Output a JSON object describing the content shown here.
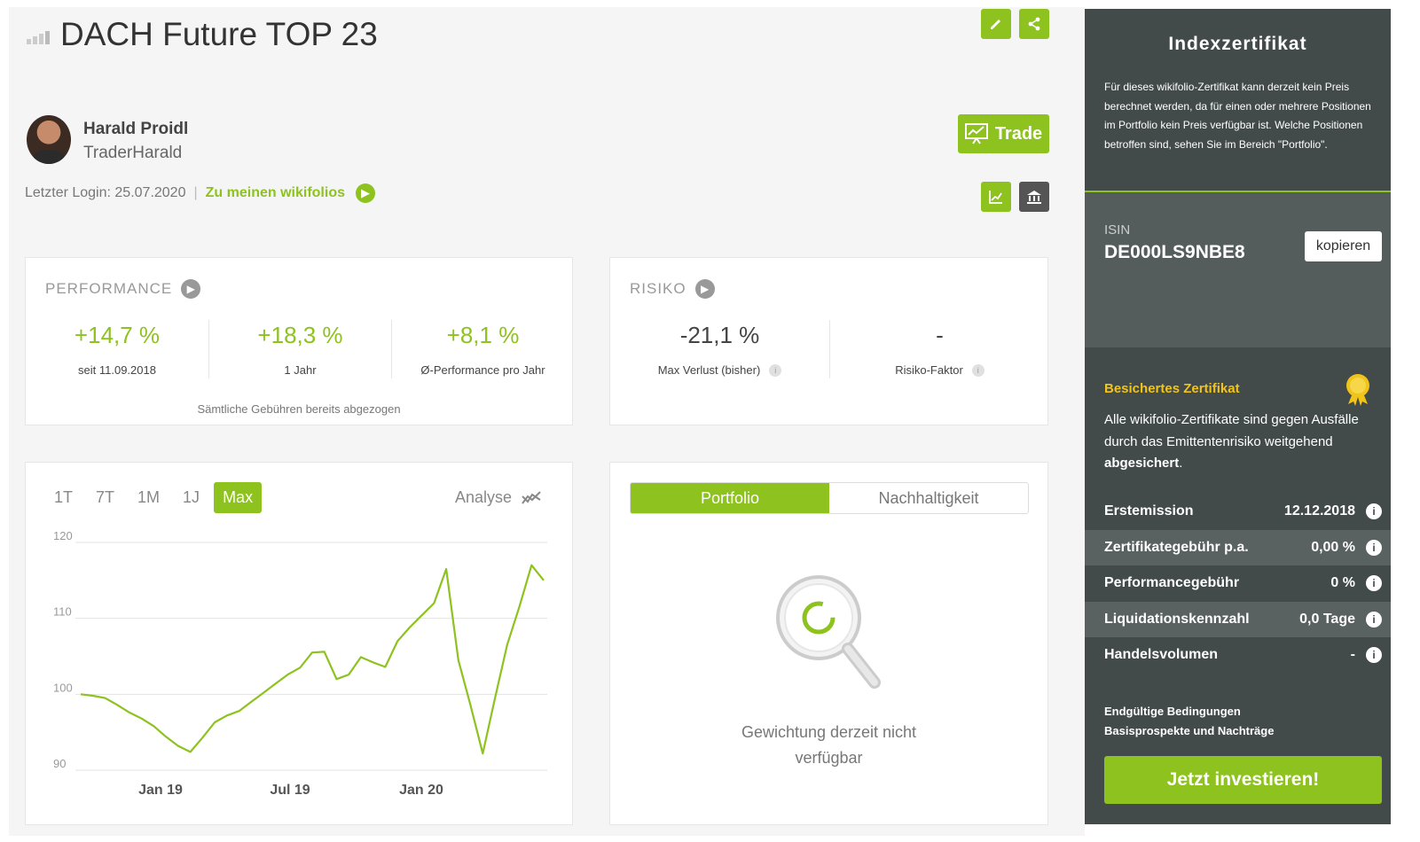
{
  "header": {
    "title": "DACH Future TOP 23"
  },
  "trader": {
    "name": "Harald Proidl",
    "handle": "TraderHarald",
    "last_login": "Letzter Login: 25.07.2020",
    "separator": "|",
    "my_wikifolios_link": "Zu meinen wikifolios"
  },
  "trade_button": "Trade",
  "performance": {
    "heading": "PERFORMANCE",
    "kpis": [
      {
        "value": "+14,7 %",
        "label": "seit 11.09.2018"
      },
      {
        "value": "+18,3 %",
        "label": "1 Jahr"
      },
      {
        "value": "+8,1 %",
        "label": "Ø-Performance pro Jahr"
      }
    ],
    "note": "Sämtliche Gebühren bereits abgezogen"
  },
  "risk": {
    "heading": "RISIKO",
    "kpis": [
      {
        "value": "-21,1 %",
        "label": "Max Verlust (bisher)"
      },
      {
        "value": "-",
        "label": "Risiko-Faktor"
      }
    ]
  },
  "chart_panel": {
    "ranges": [
      "1T",
      "7T",
      "1M",
      "1J",
      "Max"
    ],
    "active_range": "Max",
    "analyse_label": "Analyse"
  },
  "chart_data": {
    "type": "line",
    "title": "",
    "xlabel": "",
    "ylabel": "",
    "ylim": [
      90,
      120
    ],
    "yticks": [
      90,
      100,
      110,
      120
    ],
    "xticks": [
      "Jan 19",
      "Jul 19",
      "Jan 20"
    ],
    "accent": "#8dc21f",
    "series": [
      {
        "values": [
          100,
          99.8,
          99.5,
          98.6,
          97.6,
          96.8,
          95.8,
          94.4,
          93.2,
          92.4,
          94.3,
          96.3,
          97.2,
          97.8,
          99.0,
          100.2,
          101.4,
          102.6,
          103.5,
          105.5,
          105.6,
          102.0,
          102.6,
          104.9,
          104.2,
          103.6,
          107.0,
          108.8,
          110.4,
          112.0,
          116.5,
          104.5,
          98.5,
          92.2,
          99.5,
          106.5,
          111.5,
          117.0,
          115.0
        ]
      }
    ]
  },
  "tabs_panel": {
    "tabs": [
      "Portfolio",
      "Nachhaltigkeit"
    ],
    "active_tab": "Portfolio",
    "empty_line1": "Gewichtung derzeit nicht",
    "empty_line2": "verfügbar"
  },
  "sidebar": {
    "title": "Indexzertifikat",
    "notice": "Für dieses wikifolio-Zertifikat kann derzeit kein Preis berechnet werden, da für einen oder mehrere Positionen im Portfolio kein Preis verfügbar ist. Welche Positionen betroffen sind, sehen Sie im Bereich \"Portfolio\".",
    "isin_label": "ISIN",
    "isin_value": "DE000LS9NBE8",
    "copy_button": "kopieren",
    "secure_title": "Besichertes Zertifikat",
    "secure_text_pre": "Alle wikifolio-Zertifikate sind gegen Ausfälle durch das Emittentenrisiko weitgehend ",
    "secure_text_bold": "abgesichert",
    "secure_text_post": ".",
    "facts": [
      {
        "key": "Erstemission",
        "value": "12.12.2018"
      },
      {
        "key": "Zertifikategebühr p.a.",
        "value": "0,00 %"
      },
      {
        "key": "Performancegebühr",
        "value": "0 %"
      },
      {
        "key": "Liquidationskennzahl",
        "value": "0,0 Tage"
      },
      {
        "key": "Handelsvolumen",
        "value": "-"
      }
    ],
    "doc_link_1": "Endgültige Bedingungen",
    "doc_link_2": "Basisprospekte und Nachträge",
    "invest_button": "Jetzt investieren!"
  }
}
